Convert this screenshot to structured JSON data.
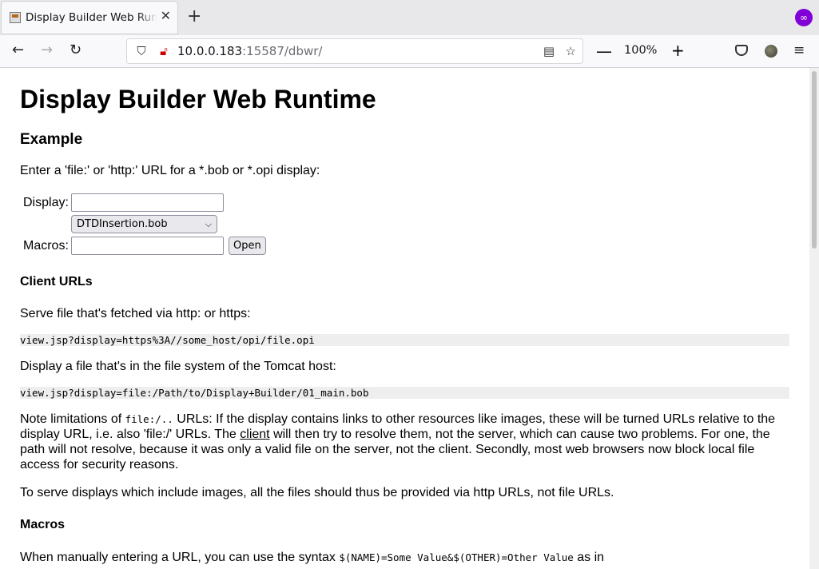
{
  "browser": {
    "tab_title": "Display Builder Web Runtime",
    "tab_close": "✕",
    "new_tab": "+",
    "url_host": "10.0.0.183",
    "url_rest": ":15587/dbwr/",
    "zoom_minus": "—",
    "zoom_level": "100%",
    "zoom_plus": "+",
    "icons": {
      "back": "←",
      "forward": "→",
      "reload": "↻",
      "shield": "⛉",
      "lock": "🔓︎",
      "reader": "▤",
      "star": "☆",
      "menu": "≡",
      "private": "∞"
    }
  },
  "page": {
    "title": "Display Builder Web Runtime",
    "example_heading": "Example",
    "example_intro": "Enter a 'file:' or 'http:' URL for a *.bob or *.opi display:",
    "display_label": "Display:",
    "display_value": "",
    "display_select": "DTDInsertion.bob",
    "macros_label": "Macros:",
    "macros_value": "",
    "open_button": "Open",
    "client_urls_heading": "Client URLs",
    "serve_http_text": "Serve file that's fetched via http: or https:",
    "serve_http_code": "view.jsp?display=https%3A//some_host/opi/file.opi",
    "file_system_text": "Display a file that's in the file system of the Tomcat host:",
    "file_system_code": "view.jsp?display=file:/Path/to/Display+Builder/01_main.bob",
    "note_prefix": "Note limitations of ",
    "note_code": "file:/..",
    "note_part1": " URLs: If the display contains links to other resources like images, these will be turned URLs relative to the display URL, i.e. also 'file:/' URLs. The ",
    "note_link": "client",
    "note_part2": " will then try to resolve them, not the server, which can cause two problems. For one, the path will not resolve, because it was only a valid file on the server, not the client. Secondly, most web browsers now block local file access for security reasons.",
    "images_text": "To serve displays which include images, all the files should thus be provided via http URLs, not file URLs.",
    "macros_heading": "Macros",
    "macros_text_prefix": "When manually entering a URL, you can use the syntax ",
    "macros_code": "$(NAME)=Some Value&$(OTHER)=Other Value",
    "macros_text_suffix": " as in"
  }
}
